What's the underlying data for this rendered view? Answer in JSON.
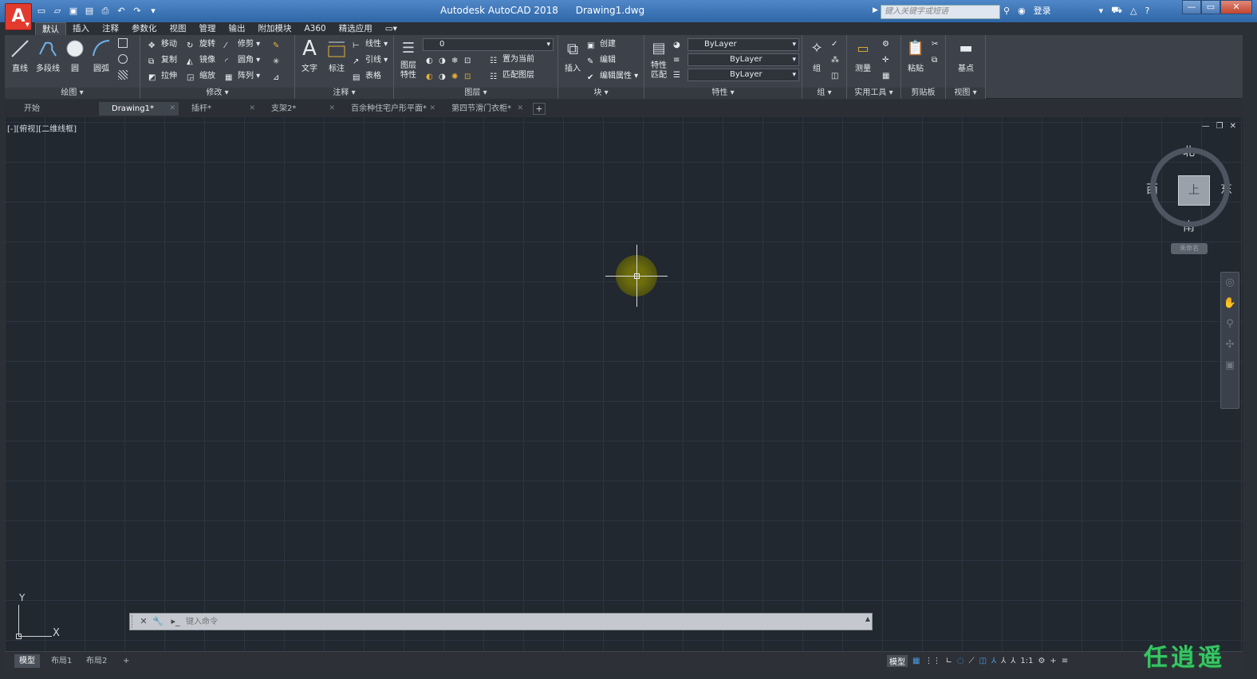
{
  "window": {
    "app_title": "Autodesk AutoCAD 2018",
    "file_title": "Drawing1.dwg",
    "search_placeholder": "键入关键字或短语",
    "login_label": "登录"
  },
  "ribbon_tabs": [
    "默认",
    "插入",
    "注释",
    "参数化",
    "视图",
    "管理",
    "输出",
    "附加模块",
    "A360",
    "精选应用"
  ],
  "panels": {
    "draw": {
      "label": "绘图 ▾",
      "line": "直线",
      "polyline": "多段线",
      "circle": "圆",
      "arc": "圆弧"
    },
    "modify": {
      "label": "修改 ▾",
      "move": "移动",
      "rotate": "旋转",
      "trim": "修剪 ▾",
      "copy": "复制",
      "mirror": "镜像",
      "fillet": "圆角 ▾",
      "stretch": "拉伸",
      "scale": "缩放",
      "array": "阵列 ▾"
    },
    "annotation": {
      "label": "注释 ▾",
      "text": "文字",
      "dimension": "标注",
      "linear": "线性 ▾",
      "leader": "引线 ▾",
      "table": "表格"
    },
    "layers": {
      "label": "图层 ▾",
      "layer_props": "图层特性",
      "layer_value": "0",
      "set_current": "置为当前",
      "match_layer": "匹配图层"
    },
    "block": {
      "label": "块 ▾",
      "insert": "插入",
      "create": "创建",
      "edit": "编辑",
      "edit_attr": "编辑属性 ▾"
    },
    "properties": {
      "label": "特性 ▾",
      "match": "特性匹配",
      "color": "ByLayer",
      "linetype": "ByLayer",
      "lineweight": "ByLayer"
    },
    "groups": {
      "label": "组 ▾",
      "group": "组"
    },
    "utilities": {
      "label": "实用工具 ▾",
      "measure": "测量"
    },
    "clipboard": {
      "label": "剪贴板",
      "paste": "粘贴"
    },
    "view": {
      "label": "视图 ▾",
      "base": "基点"
    }
  },
  "file_tabs": [
    {
      "label": "开始"
    },
    {
      "label": "Drawing1*"
    },
    {
      "label": "插杆*"
    },
    {
      "label": "支架2*"
    },
    {
      "label": "百余种住宅户形平面*"
    },
    {
      "label": "第四节滑门衣柜*"
    }
  ],
  "viewport": {
    "label": "[-][俯视][二维线框]",
    "north": "北",
    "south": "南",
    "east": "东",
    "west": "西",
    "cube_face": "上",
    "wcs": "未命名"
  },
  "ucs": {
    "x": "X",
    "y": "Y"
  },
  "command": {
    "placeholder": "键入命令"
  },
  "layout_tabs": [
    "模型",
    "布局1",
    "布局2"
  ],
  "status": {
    "model": "模型",
    "scale": "1:1"
  },
  "watermark": "任逍遥"
}
